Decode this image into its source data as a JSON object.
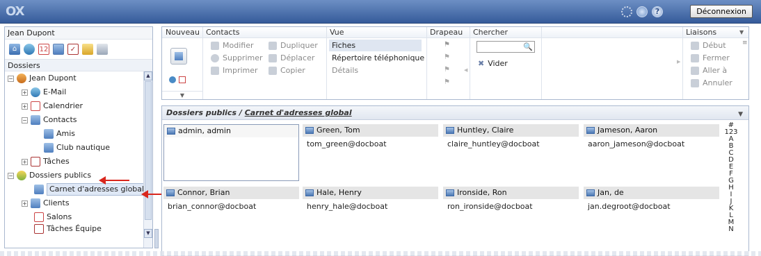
{
  "topbar": {
    "logo": "OX",
    "logout_label": "Déconnexion",
    "icons": [
      "spinner-icon",
      "refresh-icon",
      "help-icon"
    ]
  },
  "left": {
    "user_name": "Jean Dupont",
    "folders_label": "Dossiers",
    "app_icons": [
      "home-icon",
      "mail-icon",
      "calendar-icon",
      "contacts-icon",
      "tasks-icon",
      "infostore-icon",
      "projects-icon"
    ],
    "tree": [
      {
        "label": "Jean Dupont",
        "level": 0,
        "expander": "⊟",
        "icon": "user"
      },
      {
        "label": "E-Mail",
        "level": 1,
        "expander": "⊞",
        "icon": "mail"
      },
      {
        "label": "Calendrier",
        "level": 1,
        "expander": "⊞",
        "icon": "cal"
      },
      {
        "label": "Contacts",
        "level": 1,
        "expander": "⊟",
        "icon": "contact"
      },
      {
        "label": "Amis",
        "level": 2,
        "expander": "",
        "icon": "contact"
      },
      {
        "label": "Club nautique",
        "level": 2,
        "expander": "",
        "icon": "contact"
      },
      {
        "label": "Tâches",
        "level": 1,
        "expander": "⊞",
        "icon": "task"
      },
      {
        "label": "Dossiers publics",
        "level": 0,
        "expander": "⊟",
        "icon": "public"
      },
      {
        "label": "Carnet d'adresses global",
        "level": 1,
        "expander": "",
        "icon": "contact",
        "selected": true
      },
      {
        "label": "Clients",
        "level": 1,
        "expander": "⊞",
        "icon": "contact"
      },
      {
        "label": "Salons",
        "level": 1,
        "expander": "",
        "icon": "cal"
      },
      {
        "label": "Tâches Équipe",
        "level": 1,
        "expander": "",
        "icon": "task"
      }
    ]
  },
  "toolbar": {
    "sections": {
      "new": "Nouveau",
      "contacts": "Contacts",
      "view": "Vue",
      "flag": "Drapeau",
      "search": "Chercher",
      "links": "Liaisons"
    },
    "contacts_actions": {
      "edit": "Modifier",
      "duplicate": "Dupliquer",
      "delete": "Supprimer",
      "move": "Déplacer",
      "print": "Imprimer",
      "copy": "Copier"
    },
    "view_options": {
      "cards": "Fiches",
      "phonebook": "Répertoire téléphonique",
      "details": "Détails"
    },
    "search": {
      "value": "",
      "clear_label": "Vider"
    },
    "links_actions": {
      "start": "Début",
      "close": "Fermer",
      "goto": "Aller à",
      "cancel": "Annuler"
    }
  },
  "content": {
    "breadcrumb_root": "Dossiers publics",
    "breadcrumb_sep": " / ",
    "breadcrumb_current": "Carnet d'adresses global",
    "cards": [
      {
        "name": "admin, admin",
        "email": "",
        "selected": true
      },
      {
        "name": "Green, Tom",
        "email": "tom_green@docboat"
      },
      {
        "name": "Huntley, Claire",
        "email": "claire_huntley@docboat"
      },
      {
        "name": "Jameson, Aaron",
        "email": "aaron_jameson@docboat"
      },
      {
        "name": "Connor, Brian",
        "email": "brian_connor@docboat"
      },
      {
        "name": "Hale, Henry",
        "email": "henry_hale@docboat"
      },
      {
        "name": "Ironside, Ron",
        "email": "ron_ironside@docboat"
      },
      {
        "name": "Jan, de",
        "email": "jan.degroot@docboat"
      }
    ],
    "alphabet": [
      "#",
      "123",
      "A",
      "B",
      "C",
      "D",
      "E",
      "F",
      "G",
      "H",
      "I",
      "J",
      "K",
      "L",
      "M",
      "N"
    ]
  },
  "colors": {
    "topbar": "#355b9a",
    "arrow": "#d9261c",
    "selection": "#dfe8f6"
  }
}
